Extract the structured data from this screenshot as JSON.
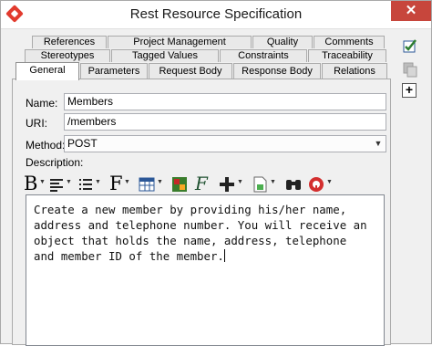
{
  "window": {
    "title": "Rest Resource Specification",
    "close_glyph": "✕"
  },
  "tabs": {
    "row3": [
      "References",
      "Project Management",
      "Quality",
      "Comments"
    ],
    "row2": [
      "Stereotypes",
      "Tagged Values",
      "Constraints",
      "Traceability"
    ],
    "row1": [
      "General",
      "Parameters",
      "Request Body",
      "Response Body",
      "Relations"
    ],
    "active": "General"
  },
  "form": {
    "name_label": "Name:",
    "name_value": "Members",
    "uri_label": "URI:",
    "uri_value": "/members",
    "method_label": "Method:",
    "method_value": "POST",
    "description_label": "Description:"
  },
  "toolbar": {
    "icons": [
      "bold-icon",
      "align-icon",
      "list-icon",
      "font-icon",
      "table-icon",
      "image-icon",
      "format-icon",
      "insert-icon",
      "template-icon",
      "find-icon",
      "spellcheck-icon"
    ],
    "bold_glyph": "B",
    "font_glyph": "F"
  },
  "description_text": "Create a new member by providing his/her name,\naddress and telephone number. You will receive an\nobject that holds the name, address, telephone\nand member ID of the member.",
  "side": {
    "icons": [
      "edit-check-icon",
      "copy-icon",
      "expand-icon"
    ],
    "expand_glyph": "+"
  },
  "colors": {
    "close": "#c7463c",
    "accent_red": "#e23b2e"
  }
}
